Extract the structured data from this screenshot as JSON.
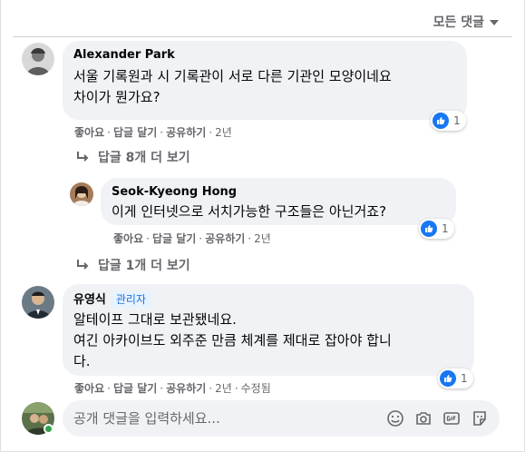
{
  "sort_label": "모든 댓글",
  "comments": [
    {
      "author": "Alexander Park",
      "lines": [
        "서울 기록원과 시 기록관이 서로 다른 기관인 모양이네요",
        "차이가 뭔가요?"
      ],
      "like_label": "좋아요",
      "reply_label": "답글 달기",
      "share_label": "공유하기",
      "time": "2년",
      "reaction_count": "1"
    },
    {
      "author": "Seok-Kyeong Hong",
      "lines": [
        "이게 인터넷으로 서치가능한 구조들은 아닌거죠?"
      ],
      "like_label": "좋아요",
      "reply_label": "답글 달기",
      "share_label": "공유하기",
      "time": "2년",
      "reaction_count": "1"
    },
    {
      "author": "유영식",
      "badge": "관리자",
      "lines": [
        "알테이프 그대로 보관됐네요.",
        "여긴 아카이브도 외주준 만큼 체계를 제대로 잡아야 합니",
        "다."
      ],
      "like_label": "좋아요",
      "reply_label": "답글 달기",
      "share_label": "공유하기",
      "time": "2년",
      "edited": "수정됨",
      "reaction_count": "1"
    }
  ],
  "view_replies": [
    {
      "label": "답글 8개 더 보기"
    },
    {
      "label": "답글 1개 더 보기"
    }
  ],
  "compose": {
    "placeholder": "공개 댓글을 입력하세요..."
  },
  "colors": {
    "accent": "#1877f2",
    "bubble": "#f0f2f5",
    "muted": "#65676b",
    "online": "#31a24c"
  },
  "icons": [
    "sort-caret-icon",
    "like-icon",
    "reply-arrow-icon",
    "emoji-icon",
    "camera-icon",
    "gif-icon",
    "sticker-icon"
  ]
}
